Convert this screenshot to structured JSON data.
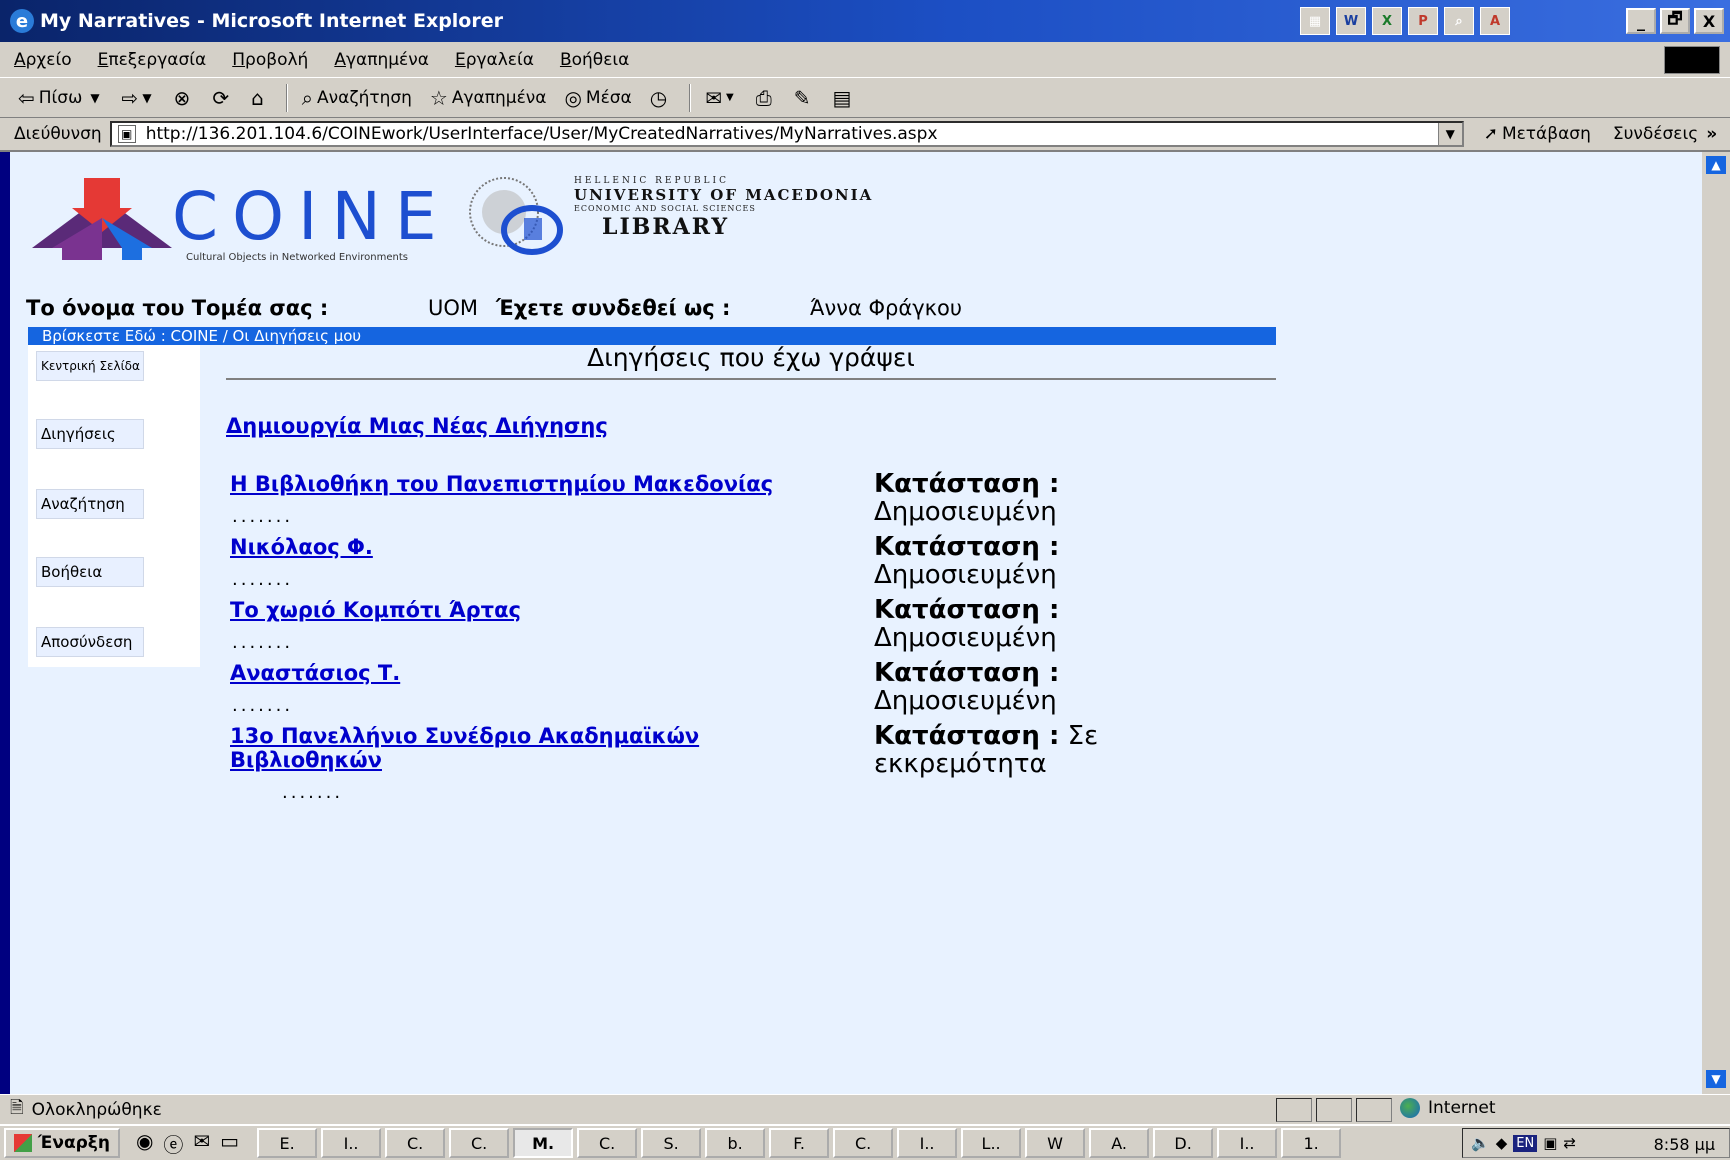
{
  "window": {
    "title": "My Narratives - Microsoft Internet Explorer",
    "controls": [
      "_",
      "🗗",
      "X"
    ]
  },
  "menu": {
    "items": [
      "Αρχείο",
      "Επεξεργασία",
      "Προβολή",
      "Αγαπημένα",
      "Εργαλεία",
      "Βοήθεια"
    ]
  },
  "toolbar": {
    "back": "Πίσω",
    "search": "Αναζήτηση",
    "favorites": "Αγαπημένα",
    "media": "Μέσα"
  },
  "address": {
    "label": "Διεύθυνση",
    "url": "http://136.201.104.6/COINEwork/UserInterface/User/MyCreatedNarratives/MyNarratives.aspx",
    "go": "Μετάβαση",
    "links": "Συνδέσεις"
  },
  "page": {
    "logo": {
      "name": "COINE",
      "subtitle": "Cultural Objects in Networked Environments",
      "library_top": "HELLENIC REPUBLIC",
      "library_uni": "UNIVERSITY OF MACEDONIA",
      "library_econ": "ECONOMIC AND SOCIAL SCIENCES",
      "library_name": "LIBRARY"
    },
    "sector_label": "Το όνομα του Τομέα σας :",
    "sector_value": "UOM",
    "user_label": "Έχετε συνδεθεί ως :",
    "user_value": "Άννα Φράγκου",
    "breadcrumb": "Βρίσκεστε Εδώ : COINE / Οι Διηγήσεις μου",
    "sidebar": [
      "Κεντρική Σελίδα",
      "Διηγήσεις",
      "Αναζήτηση",
      "Βοήθεια",
      "Αποσύνδεση"
    ],
    "heading": "Διηγήσεις που έχω γράψει",
    "create_link": "Δημιουργία Μιας Νέας Διήγησης",
    "status_label": "Κατάσταση :",
    "dots": ".......",
    "narratives": [
      {
        "title": "Η Βιβλιοθήκη του Πανεπιστημίου Μακεδονίας",
        "status": "Δημοσιευμένη"
      },
      {
        "title": "Νικόλαος Φ.",
        "status": "Δημοσιευμένη"
      },
      {
        "title": "Το χωριό Κομπότι Άρτας",
        "status": "Δημοσιευμένη"
      },
      {
        "title": "Αναστάσιος Τ.",
        "status": "Δημοσιευμένη"
      },
      {
        "title": "13ο Πανελλήνιο Συνέδριο Ακαδημαϊκών Βιβλιοθηκών",
        "status": "Σε εκκρεμότητα"
      }
    ]
  },
  "statusbar": {
    "text": "Ολοκληρώθηκε",
    "zone": "Internet"
  },
  "taskbar": {
    "start": "Έναρξη",
    "tasks": [
      "E.",
      "I..",
      "C.",
      "C.",
      "M.",
      "C.",
      "S.",
      "b.",
      "F.",
      "C.",
      "I..",
      "L..",
      "W",
      "A.",
      "D.",
      "I..",
      "1."
    ],
    "lang": "EN",
    "clock": "8:58 μμ"
  }
}
